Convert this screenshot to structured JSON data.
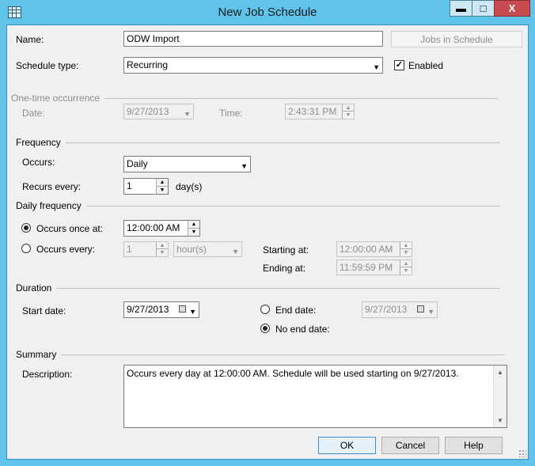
{
  "window": {
    "title": "New Job Schedule",
    "minimize": "▬",
    "maximize": "□",
    "close": "X"
  },
  "name": {
    "label": "Name:",
    "value": "ODW Import",
    "jobs_button": "Jobs in Schedule"
  },
  "schedule_type": {
    "label": "Schedule type:",
    "value": "Recurring",
    "enabled_label": "Enabled",
    "enabled": true
  },
  "one_time": {
    "heading": "One-time occurrence",
    "date_label": "Date:",
    "date_value": "9/27/2013",
    "time_label": "Time:",
    "time_value": "2:43:31 PM"
  },
  "frequency": {
    "heading": "Frequency",
    "occurs_label": "Occurs:",
    "occurs_value": "Daily",
    "recurs_label": "Recurs every:",
    "recurs_value": "1",
    "recurs_unit": "day(s)"
  },
  "daily_frequency": {
    "heading": "Daily frequency",
    "once_label": "Occurs once at:",
    "once_value": "12:00:00 AM",
    "every_label": "Occurs every:",
    "every_value": "1",
    "every_unit": "hour(s)",
    "starting_label": "Starting at:",
    "starting_value": "12:00:00 AM",
    "ending_label": "Ending at:",
    "ending_value": "11:59:59 PM",
    "selected": "once"
  },
  "duration": {
    "heading": "Duration",
    "start_label": "Start date:",
    "start_value": "9/27/2013",
    "end_label": "End date:",
    "end_value": "9/27/2013",
    "no_end_label": "No end date:",
    "selected": "no_end"
  },
  "summary": {
    "heading": "Summary",
    "description_label": "Description:",
    "description": "Occurs every day at 12:00:00 AM. Schedule will be used starting on 9/27/2013."
  },
  "buttons": {
    "ok": "OK",
    "cancel": "Cancel",
    "help": "Help"
  },
  "icons": {
    "app": "schedule-grid-icon",
    "dropdown": "chevron-down-icon",
    "spin_up": "spin-up-icon",
    "spin_down": "spin-down-icon",
    "calendar": "calendar-icon"
  },
  "colors": {
    "title_bar": "#5fc3ea",
    "close_button": "#c74b50",
    "dialog_bg": "#f0f0f0",
    "disabled_text": "#8d8d8d"
  }
}
